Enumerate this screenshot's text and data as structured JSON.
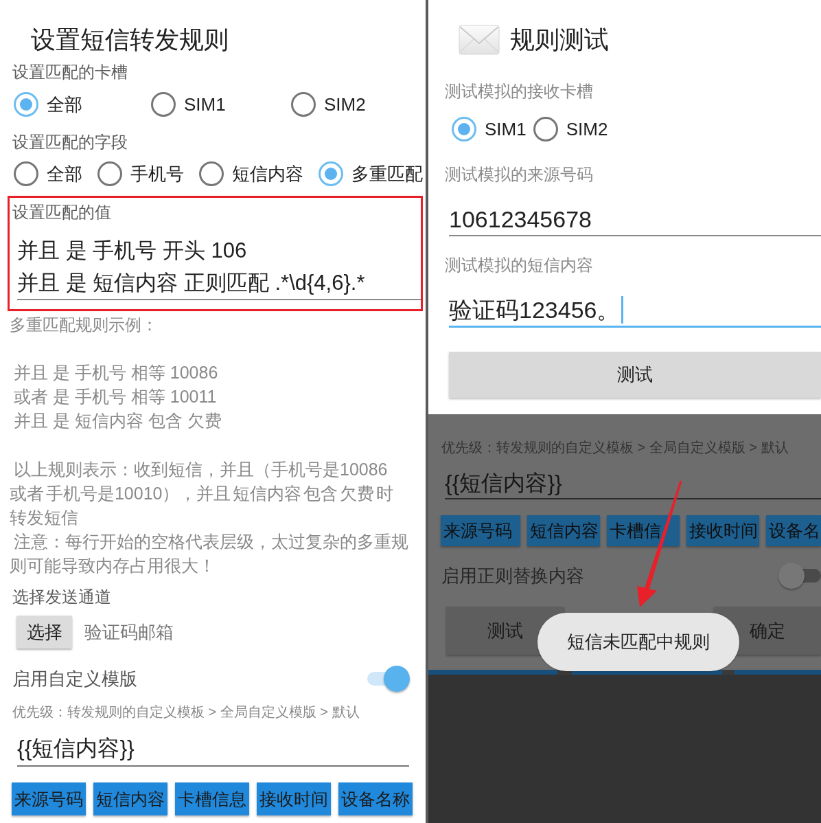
{
  "rule_dialog": {
    "title": "设置短信转发规则",
    "sim_slot": {
      "label": "设置匹配的卡槽",
      "options": [
        {
          "label": "全部",
          "selected": true
        },
        {
          "label": "SIM1",
          "selected": false
        },
        {
          "label": "SIM2",
          "selected": false
        }
      ]
    },
    "match_field": {
      "label": "设置匹配的字段",
      "options": [
        {
          "label": "全部",
          "selected": false
        },
        {
          "label": "手机号",
          "selected": false
        },
        {
          "label": "短信内容",
          "selected": false
        },
        {
          "label": "多重匹配",
          "selected": true
        }
      ]
    },
    "match_value": {
      "label": "设置匹配的值",
      "value": "并且 是 手机号 开头 106\n并且 是 短信内容 正则匹配 .*\\d{4,6}.*",
      "highlighted": true
    },
    "example": {
      "heading": "多重匹配规则示例：",
      "rules": [
        "并且 是 手机号 相等 10086",
        "或者 是 手机号 相等 10011",
        "并且 是 短信内容 包含 欠费"
      ],
      "explanation": "以上规则表示：收到短信，并且（手机号是10086或者 手机号是10010），并且 短信内容 包含 欠费 时转发短信",
      "note": "注意：每行开始的空格代表层级，太过复杂的多重规则可能导致内存占用很大！"
    },
    "channel": {
      "label": "选择发送通道",
      "button": "选择",
      "value": "验证码邮箱"
    },
    "custom_template": {
      "label": "启用自定义模版",
      "on": true,
      "hint": "优先级：转发规则的自定义模板 > 全局自定义模版 > 默认",
      "value": "{{短信内容}}",
      "tags": [
        "来源号码",
        "短信内容",
        "卡槽信息",
        "接收时间",
        "设备名称"
      ]
    }
  },
  "test_screen": {
    "dialog": {
      "title": "规则测试",
      "slot_label": "测试模拟的接收卡槽",
      "slots": [
        {
          "label": "SIM1",
          "selected": true
        },
        {
          "label": "SIM2",
          "selected": false
        }
      ],
      "number_field": {
        "label": "测试模拟的来源号码",
        "value": "10612345678",
        "focused": false
      },
      "content_field": {
        "label": "测试模拟的短信内容",
        "value": "验证码123456。",
        "focused": true
      },
      "button": "测试"
    },
    "background": {
      "hint": "优先级：转发规则的自定义模板 > 全局自定义模版 > 默认",
      "template_value": "{{短信内容}}",
      "tags": [
        "来源号码",
        "短信内容",
        "卡槽信",
        "接收时间",
        "设备名"
      ],
      "regex_label": "启用正则替换内容",
      "regex_on": false,
      "buttons": [
        "测试",
        "确定"
      ]
    },
    "toast": {
      "message": "短信未匹配中规则"
    }
  }
}
